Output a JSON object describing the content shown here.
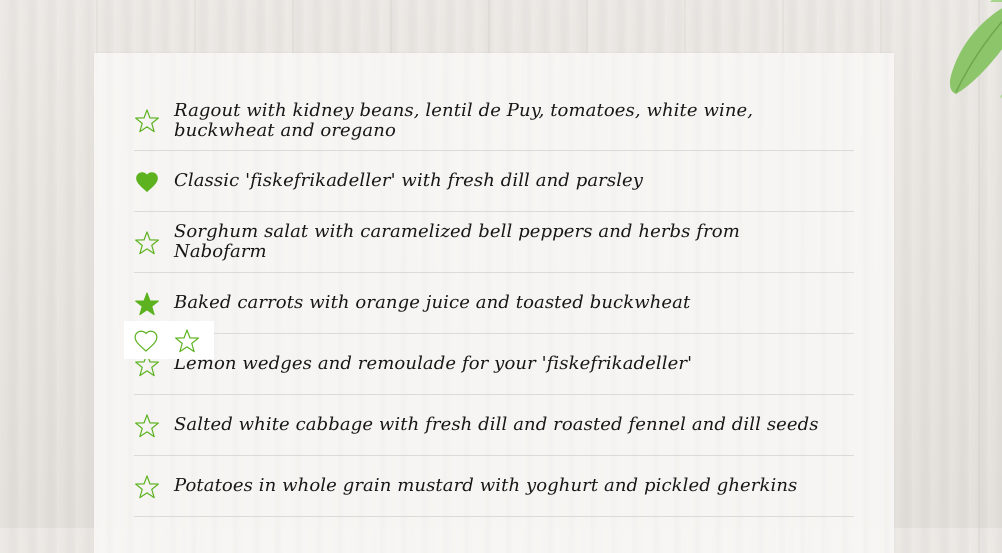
{
  "menu": {
    "items": [
      {
        "label": "Ragout with kidney beans, lentil de Puy, tomatoes, white wine, buckwheat and oregano",
        "icon": "star-outline-icon"
      },
      {
        "label": "Classic 'fiskefrikadeller' with fresh dill and parsley",
        "icon": "heart-filled-icon"
      },
      {
        "label": "Sorghum salat with caramelized bell peppers and herbs from Nabofarm",
        "icon": "star-outline-icon"
      },
      {
        "label": "Baked carrots with orange juice and toasted buckwheat",
        "icon": "star-filled-icon"
      },
      {
        "label": "Lemon wedges and remoulade for your 'fiskefrikadeller'",
        "icon": "star-outline-icon"
      },
      {
        "label": "Salted white cabbage with fresh dill and roasted fennel and dill seeds",
        "icon": "star-outline-icon"
      },
      {
        "label": "Potatoes in whole grain mustard with yoghurt and pickled gherkins",
        "icon": "star-outline-icon"
      }
    ]
  },
  "popover": {
    "icons": [
      "heart-outline-icon",
      "star-outline-icon"
    ]
  },
  "colors": {
    "accent_green": "#5cb21f",
    "text": "#161616",
    "divider": "#dcdad6",
    "card_background": "#f7f6f4",
    "page_background": "#e6e3df"
  }
}
